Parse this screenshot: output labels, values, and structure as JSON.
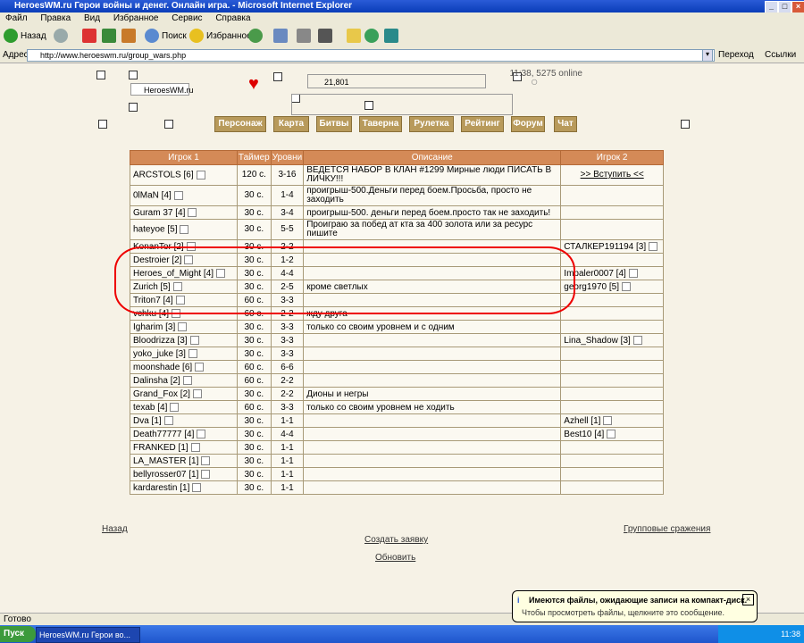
{
  "window": {
    "title": "HeroesWM.ru Герои войны и денег. Онлайн игра. - Microsoft Internet Explorer"
  },
  "menu": [
    "Файл",
    "Правка",
    "Вид",
    "Избранное",
    "Сервис",
    "Справка"
  ],
  "toolbar": {
    "back": "Назад",
    "search": "Поиск",
    "favorites": "Избранное"
  },
  "address": {
    "label": "Адрес:",
    "url": "http://www.heroeswm.ru/group_wars.php",
    "go": "Переход",
    "links": "Ссылки"
  },
  "header": {
    "site_name": "HeroesWM.ru",
    "online": "11:38, 5275 online",
    "resource_value": "21,801"
  },
  "nav": [
    "Персонаж",
    "Карта",
    "Битвы",
    "Таверна",
    "Рулетка",
    "Рейтинг",
    "Форум",
    "Чат"
  ],
  "table": {
    "headers": [
      "Игрок 1",
      "Таймер",
      "Уровни",
      "Описание",
      "Игрок 2"
    ],
    "rows": [
      {
        "p1": "ARCSTOLS [6]",
        "timer": "120 с.",
        "levels": "3-16",
        "desc": "ВЕДЕТСЯ НАБОР В КЛАН #1299 Мирные люди ПИСАТЬ В ЛИЧКУ!!!",
        "p2": ">> Вступить <<",
        "tall": true
      },
      {
        "p1": "0lMaN [4]",
        "timer": "30 с.",
        "levels": "1-4",
        "desc": "проигрыш-500.Деньги перед боем.Просьба, просто не заходить",
        "p2": "",
        "tall": true
      },
      {
        "p1": "Guram 37 [4]",
        "timer": "30 с.",
        "levels": "3-4",
        "desc": "проигрыш-500. деньги перед боем.просто так не заходить!",
        "p2": ""
      },
      {
        "p1": "hateyoe [5]",
        "timer": "30 с.",
        "levels": "5-5",
        "desc": "Проиграю за побед ат кта за 400 золота или за ресурс пишите",
        "p2": "",
        "tall": true
      },
      {
        "p1": "KonanTor [2]",
        "timer": "30 с.",
        "levels": "2-2",
        "desc": "",
        "p2": "СТАЛКЕР191194 [3]"
      },
      {
        "p1": "Destroier [2]",
        "timer": "30 с.",
        "levels": "1-2",
        "desc": "",
        "p2": ""
      },
      {
        "p1": "Heroes_of_Might [4]",
        "timer": "30 с.",
        "levels": "4-4",
        "desc": "",
        "p2": "Impaler0007 [4]"
      },
      {
        "p1": "Zurich [5]",
        "timer": "30 с.",
        "levels": "2-5",
        "desc": "кроме светлых",
        "p2": "georg1970 [5]"
      },
      {
        "p1": "Triton7 [4]",
        "timer": "60 с.",
        "levels": "3-3",
        "desc": "",
        "p2": ""
      },
      {
        "p1": "vchku [4]",
        "timer": "60 с.",
        "levels": "2-2",
        "desc": "жду друга",
        "p2": ""
      },
      {
        "p1": "Igharim [3]",
        "timer": "30 с.",
        "levels": "3-3",
        "desc": "только со своим уровнем и с одним",
        "p2": ""
      },
      {
        "p1": "Bloodrizza [3]",
        "timer": "30 с.",
        "levels": "3-3",
        "desc": "",
        "p2": "Lina_Shadow [3]"
      },
      {
        "p1": "yoko_juke [3]",
        "timer": "30 с.",
        "levels": "3-3",
        "desc": "",
        "p2": ""
      },
      {
        "p1": "moonshade [6]",
        "timer": "60 с.",
        "levels": "6-6",
        "desc": "",
        "p2": ""
      },
      {
        "p1": "Dalinsha [2]",
        "timer": "60 с.",
        "levels": "2-2",
        "desc": "",
        "p2": ""
      },
      {
        "p1": "Grand_Fox [2]",
        "timer": "30 с.",
        "levels": "2-2",
        "desc": "Дионы и негры",
        "p2": ""
      },
      {
        "p1": "texab [4]",
        "timer": "60 с.",
        "levels": "3-3",
        "desc": "только со своим уровнем не ходить",
        "p2": ""
      },
      {
        "p1": "Dva [1]",
        "timer": "30 с.",
        "levels": "1-1",
        "desc": "",
        "p2": "Azhell [1]"
      },
      {
        "p1": "Death77777 [4]",
        "timer": "30 с.",
        "levels": "4-4",
        "desc": "",
        "p2": "Best10 [4]"
      },
      {
        "p1": "FRANKED [1]",
        "timer": "30 с.",
        "levels": "1-1",
        "desc": "",
        "p2": ""
      },
      {
        "p1": "LA_MASTER [1]",
        "timer": "30 с.",
        "levels": "1-1",
        "desc": "",
        "p2": ""
      },
      {
        "p1": "bellyrosser07 [1]",
        "timer": "30 с.",
        "levels": "1-1",
        "desc": "",
        "p2": ""
      },
      {
        "p1": "kardarestin [1]",
        "timer": "30 с.",
        "levels": "1-1",
        "desc": "",
        "p2": ""
      }
    ]
  },
  "links": {
    "back": "Назад",
    "create": "Создать заявку",
    "refresh": "Обновить",
    "right": "Групповые сражения"
  },
  "status": {
    "text": "Готово"
  },
  "taskbar": {
    "start": "Пуск",
    "task": "HeroesWM.ru Герои во...",
    "time": "11:38"
  },
  "balloon": {
    "title": "Имеются файлы, ожидающие записи на компакт-диск.",
    "body": "Чтобы просмотреть файлы, щелкните это сообщение."
  },
  "colors": {
    "header_orange": "#d48a57",
    "nav_gold": "#b89a5b",
    "annotation_red": "#e00000"
  }
}
